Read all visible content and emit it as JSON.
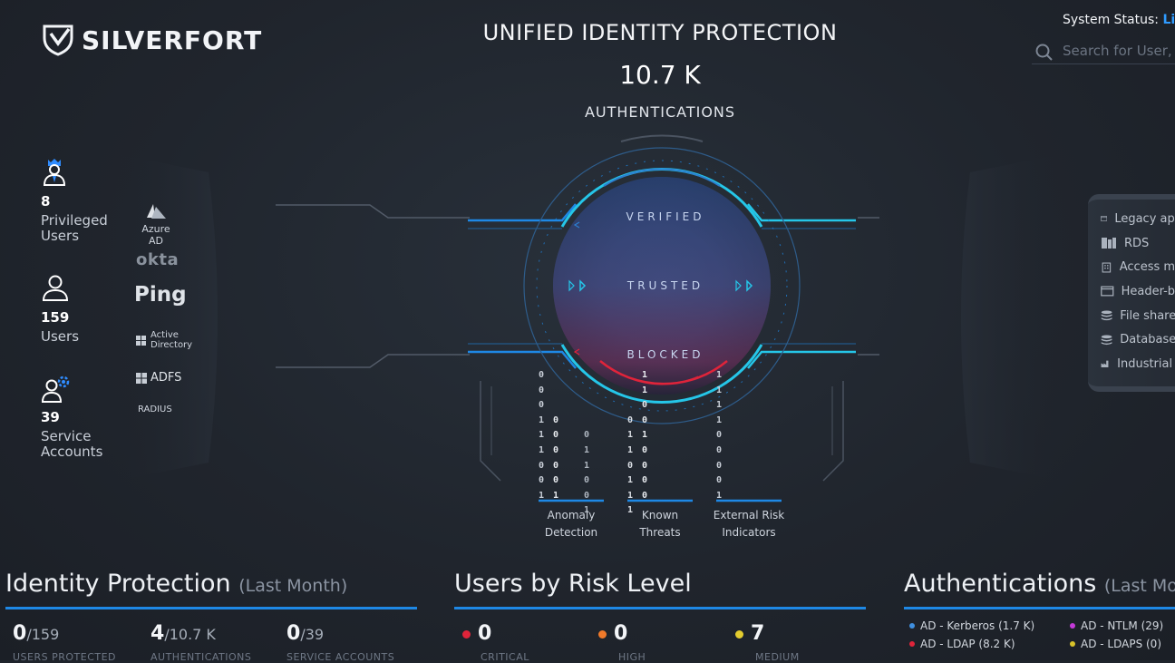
{
  "brand": {
    "name": "SILVERFORT"
  },
  "header": {
    "title": "UNIFIED IDENTITY PROTECTION",
    "count": "10.7 K",
    "subtitle": "AUTHENTICATIONS"
  },
  "system_status": {
    "label": "System Status:",
    "value": "Live"
  },
  "search": {
    "placeholder": "Search for User, Re"
  },
  "left_stats": [
    {
      "value": "8",
      "label_line1": "Privileged",
      "label_line2": "Users",
      "icon": "privileged-user-icon"
    },
    {
      "value": "159",
      "label_line1": "Users",
      "label_line2": "",
      "icon": "user-icon"
    },
    {
      "value": "39",
      "label_line1": "Service",
      "label_line2": "Accounts",
      "icon": "service-account-icon"
    }
  ],
  "identity_providers": {
    "azure": "Azure AD",
    "okta": "okta",
    "ping": "Ping",
    "ad_line1": "Active",
    "ad_line2": "Directory",
    "adfs": "ADFS",
    "radius": "RADIUS"
  },
  "ring": {
    "verified": "VERIFIED",
    "trusted": "TRUSTED",
    "blocked": "BLOCKED"
  },
  "services": [
    {
      "line1": "Anomaly",
      "line2": "Detection"
    },
    {
      "line1": "Known",
      "line2": "Threats"
    },
    {
      "line1": "External Risk",
      "line2": "Indicators"
    }
  ],
  "binary": {
    "col1": "0\n0\n0\n1\n1\n1\n0\n0\n1",
    "col2": "\n\n\n0\n0\n0\n0\n0\n1",
    "col3": "\n\n\n\n0\n1\n1\n0\n0\n1",
    "col4": "\n\n\n0\n1\n1\n0\n1\n1\n1",
    "col5": "1\n1\n0\n0\n1\n0\n0\n0\n0",
    "col6": "1\n1\n1\n1\n0\n0\n0\n0\n1"
  },
  "right_services": [
    {
      "label": "Legacy app",
      "icon": "window-icon"
    },
    {
      "label": "RDS",
      "icon": "server-icon"
    },
    {
      "label": "Access ma",
      "icon": "building-icon"
    },
    {
      "label": "Header-ba",
      "icon": "window-icon"
    },
    {
      "label": "File shares",
      "icon": "database-icon"
    },
    {
      "label": "Databases",
      "icon": "database-icon"
    },
    {
      "label": "Industrial s",
      "icon": "factory-icon"
    }
  ],
  "identity_protection": {
    "title": "Identity Protection",
    "period": "(Last Month)",
    "kpis": [
      {
        "value": "0",
        "total": "/159",
        "label": "USERS PROTECTED"
      },
      {
        "value": "4",
        "total": "/10.7 K",
        "label": "AUTHENTICATIONS"
      },
      {
        "value": "0",
        "total": "/39",
        "label": "SERVICE ACCOUNTS"
      }
    ]
  },
  "risk_level": {
    "title": "Users by Risk Level",
    "items": [
      {
        "value": "0",
        "label": "CRITICAL",
        "color": "#e0243a"
      },
      {
        "value": "0",
        "label": "HIGH",
        "color": "#f07a2a"
      },
      {
        "value": "7",
        "label": "MEDIUM",
        "color": "#e3cc2f"
      }
    ]
  },
  "authentications": {
    "title": "Authentications",
    "period": "(Last Month)",
    "items": [
      {
        "label": "AD - Kerberos (1.7 K)",
        "color": "#3f8fe0"
      },
      {
        "label": "AD - NTLM (29)",
        "color": "#c43ad8"
      },
      {
        "label": "AD - LDAP (8.2 K)",
        "color": "#e0243a"
      },
      {
        "label": "AD - LDAPS (0)",
        "color": "#d8c22a"
      }
    ]
  },
  "colors": {
    "accent": "#1e88e5",
    "cyan": "#25c6e8",
    "blocked": "#e0243a"
  }
}
